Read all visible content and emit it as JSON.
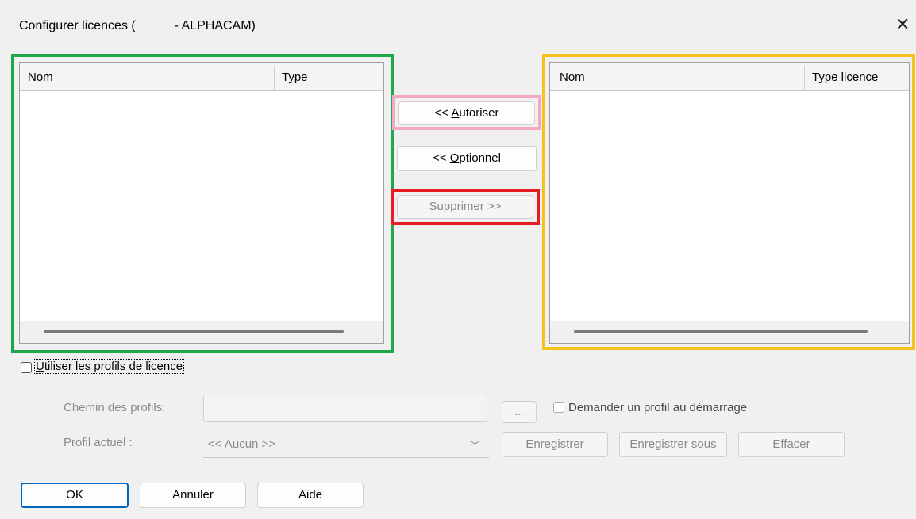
{
  "window": {
    "title": "Configurer licences (           - ALPHACAM)",
    "close_glyph": "✕"
  },
  "left_list": {
    "columns": [
      "Nom",
      "Type"
    ],
    "rows": []
  },
  "right_list": {
    "columns": [
      "Nom",
      "Type licence"
    ],
    "rows": []
  },
  "middle": {
    "allow_prefix": "<< ",
    "allow_accel": "A",
    "allow_rest": "utoriser",
    "optional_prefix": "<< ",
    "optional_accel": "O",
    "optional_rest": "ptionnel",
    "delete_label": "Supprimer >>"
  },
  "profiles": {
    "use_profiles_accel": "U",
    "use_profiles_rest": "tiliser les profils de licence",
    "path_label": "Chemin des profils:",
    "path_value": "",
    "browse_label": "...",
    "ask_label": "Demander un profil au démarrage",
    "current_label": "Profil actuel :",
    "current_value": "<< Aucun >>",
    "save_label": "Enregistrer",
    "save_as_label": "Enregistrer sous",
    "clear_label": "Effacer"
  },
  "footer": {
    "ok_label": "OK",
    "cancel_label": "Annuler",
    "help_label": "Aide"
  },
  "colors": {
    "left_frame": "#1fa84a",
    "right_frame": "#f8c21c",
    "allow_frame": "#f4a8c4",
    "delete_frame": "#e51c23",
    "ok_border": "#0067c0"
  }
}
